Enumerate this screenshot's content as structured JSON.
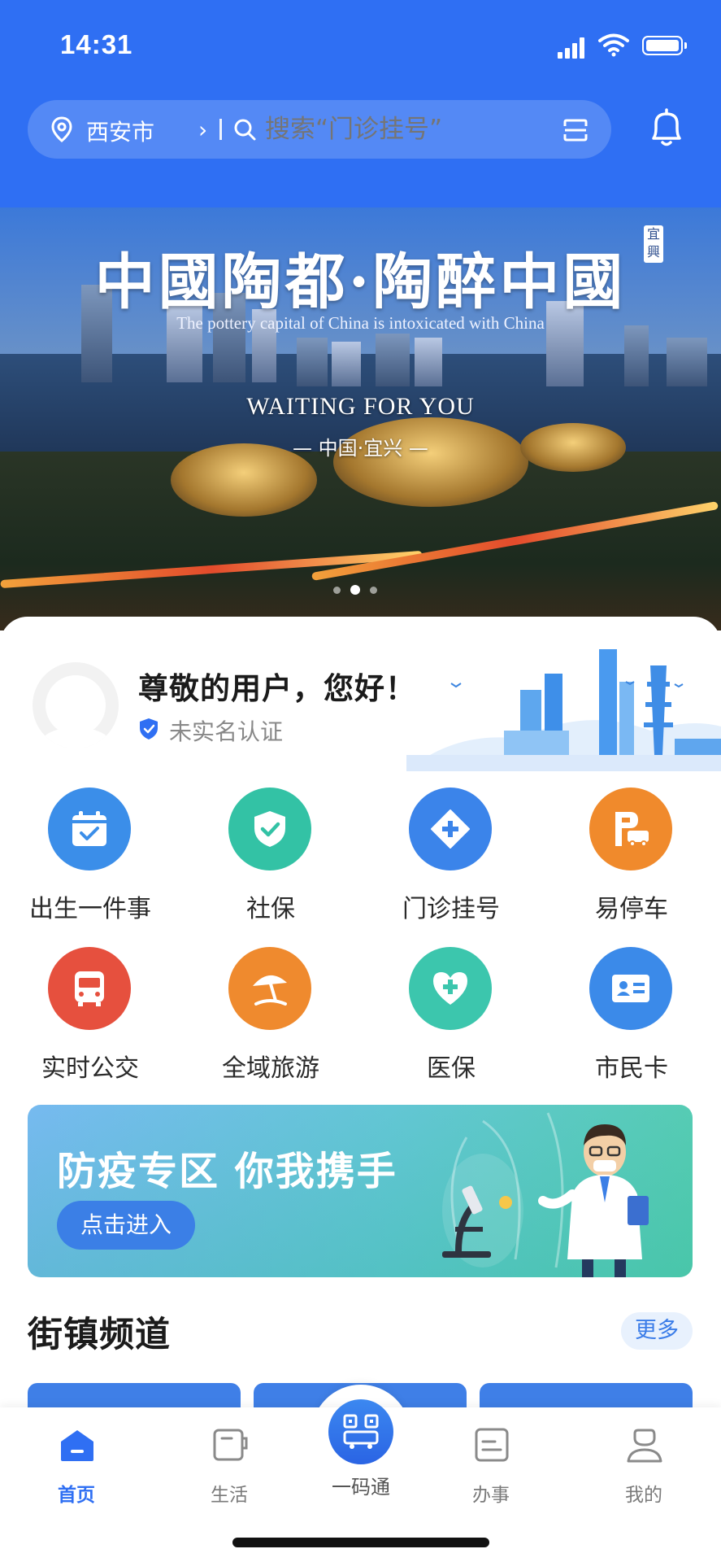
{
  "status_bar": {
    "time": "14:31"
  },
  "search": {
    "city": "西安市",
    "placeholder": "搜索“门诊挂号”"
  },
  "banner": {
    "title": "中國陶都·陶醉中國",
    "subtitle": "The pottery capital of China is intoxicated with China",
    "seal": "宜興",
    "slogan": "WAITING FOR YOU",
    "place": "— 中国·宜兴 —",
    "page_count": 3,
    "active_page": 2
  },
  "welcome": {
    "greeting": "尊敬的用户，您好！",
    "verify_status": "未实名认证"
  },
  "services": [
    {
      "label": "出生一件事",
      "icon": "calendar-check-icon",
      "color": "#3b8ee9"
    },
    {
      "label": "社保",
      "icon": "shield-check-icon",
      "color": "#33c2a5"
    },
    {
      "label": "门诊挂号",
      "icon": "medical-diamond-icon",
      "color": "#3b84ea"
    },
    {
      "label": "易停车",
      "icon": "parking-car-icon",
      "color": "#f08a2c"
    },
    {
      "label": "实时公交",
      "icon": "bus-icon",
      "color": "#e6503e"
    },
    {
      "label": "全域旅游",
      "icon": "beach-umbrella-icon",
      "color": "#ef8a2e"
    },
    {
      "label": "医保",
      "icon": "heart-plus-icon",
      "color": "#3cc6ad"
    },
    {
      "label": "市民卡",
      "icon": "id-card-icon",
      "color": "#3b8ae9"
    }
  ],
  "epidemic": {
    "title": "防疫专区 你我携手",
    "button": "点击进入"
  },
  "channel": {
    "title": "街镇频道",
    "more": "更多"
  },
  "tabbar": {
    "home": "首页",
    "life": "生活",
    "qr": "一码通",
    "affairs": "办事",
    "mine": "我的",
    "active_color": "#2f6ff3"
  },
  "colors": {
    "primary": "#2f6ff3",
    "banner_bg": "#2f6ff3"
  }
}
